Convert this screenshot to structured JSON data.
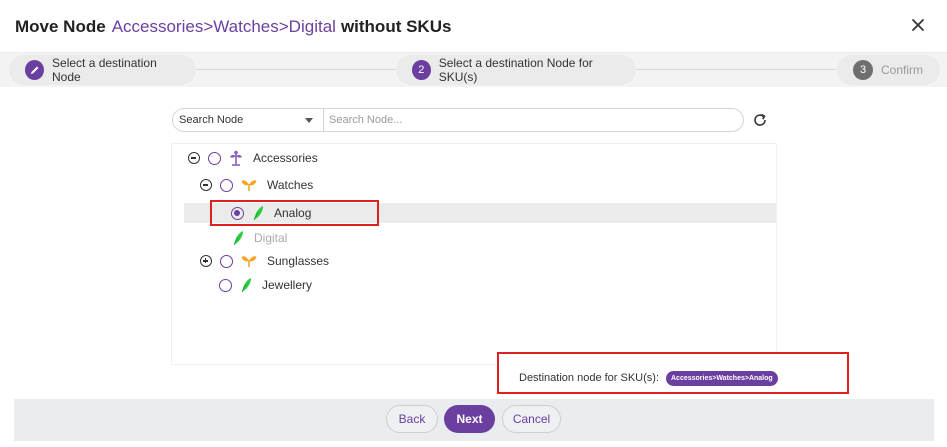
{
  "dialog": {
    "title_prefix": "Move Node",
    "title_path": "Accessories>Watches>Digital",
    "title_suffix": "without SKUs"
  },
  "steps": [
    {
      "number": "",
      "label": "Select a destination Node",
      "icon": "pencil-icon"
    },
    {
      "number": "2",
      "label": "Select a destination Node for SKU(s)"
    },
    {
      "number": "3",
      "label": "Confirm"
    }
  ],
  "search": {
    "type_selected": "Search Node",
    "placeholder": "Search Node..."
  },
  "tree": {
    "nodes": [
      {
        "label": "Accessories",
        "icon": "root-sprout-icon",
        "toggle": "collapse"
      },
      {
        "label": "Watches",
        "icon": "sprout-icon",
        "toggle": "collapse"
      },
      {
        "label": "Analog",
        "icon": "leaf-icon",
        "selected": true
      },
      {
        "label": "Digital",
        "icon": "leaf-icon",
        "disabled": true
      },
      {
        "label": "Sunglasses",
        "icon": "sprout-icon",
        "toggle": "expand"
      },
      {
        "label": "Jewellery",
        "icon": "leaf-icon"
      }
    ]
  },
  "destination": {
    "label": "Destination node for SKU(s):",
    "value": "Accessories>Watches>Analog"
  },
  "buttons": {
    "back": "Back",
    "next": "Next",
    "cancel": "Cancel"
  },
  "colors": {
    "accent": "#6b3fa0",
    "highlight": "#e02020",
    "leaf": "#2ecc40",
    "sprout": "#f5a623"
  }
}
